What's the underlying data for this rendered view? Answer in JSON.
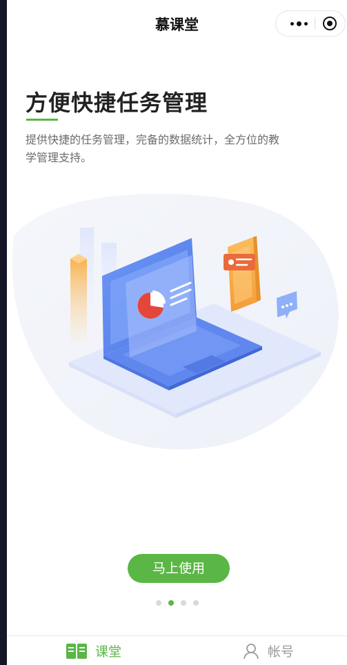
{
  "navbar": {
    "title": "慕课堂"
  },
  "hero": {
    "headline": "方便快捷任务管理",
    "description": "提供快捷的任务管理，完备的数据统计，全方位的教学管理支持。"
  },
  "actions": {
    "start_label": "马上使用"
  },
  "pager": {
    "count": 4,
    "active_index": 1
  },
  "tabbar": {
    "items": [
      {
        "label": "课堂",
        "icon": "book-icon",
        "active": true
      },
      {
        "label": "帐号",
        "icon": "user-icon",
        "active": false
      }
    ]
  },
  "colors": {
    "accent": "#5ab645",
    "inactive_tab": "#9a9a9a",
    "laptop_blue": "#5b84f0",
    "phone_orange": "#f7b04c",
    "pie_red": "#e5463a"
  }
}
